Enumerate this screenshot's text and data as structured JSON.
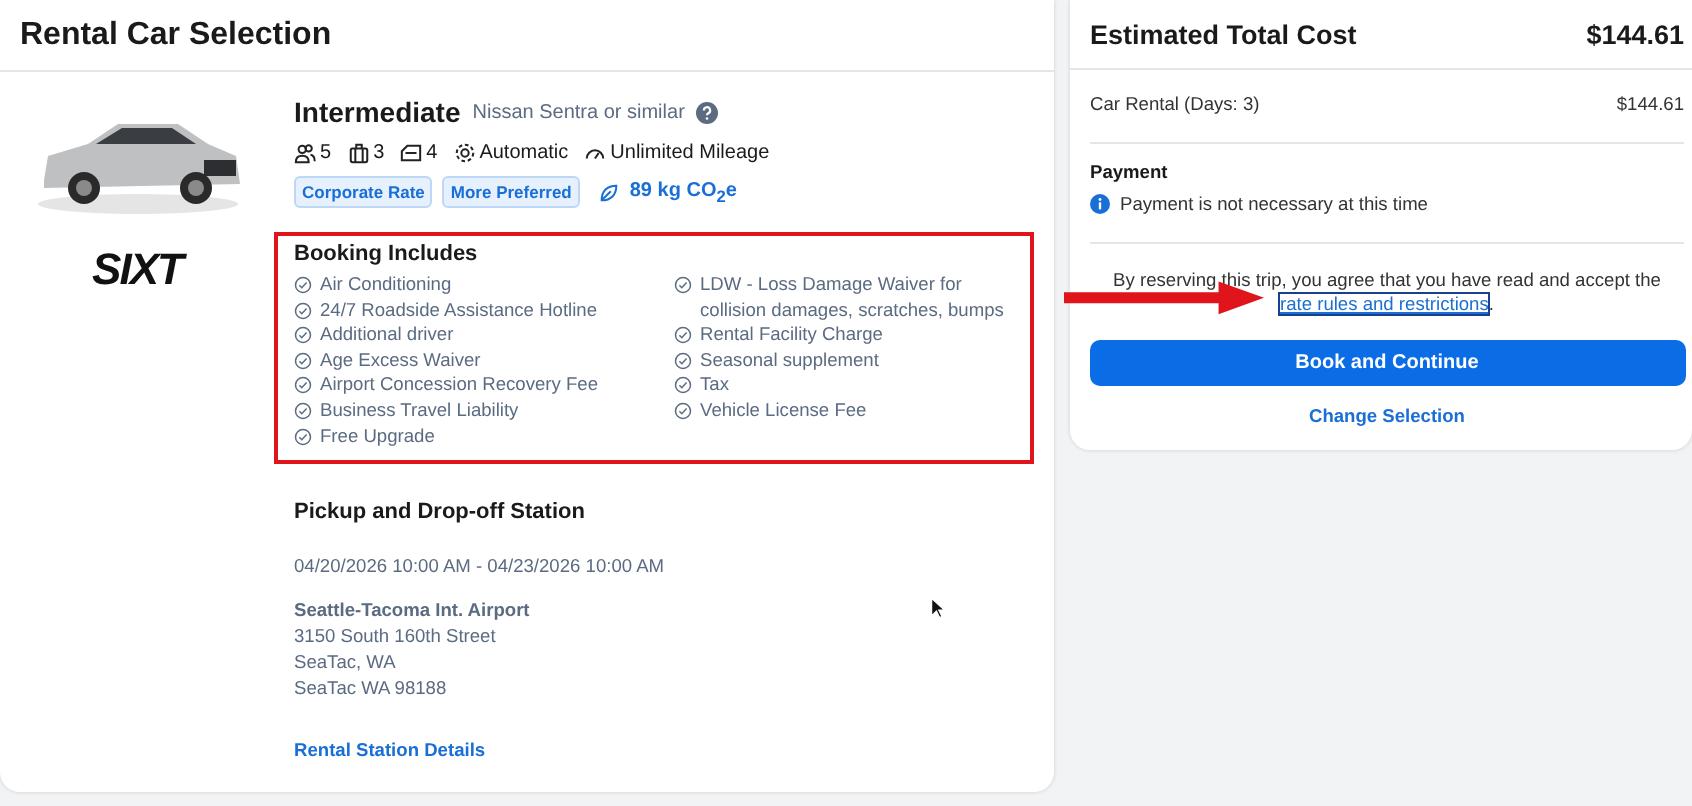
{
  "left_panel": {
    "title": "Rental Car Selection",
    "car": {
      "picture": {
        "kind": "picture"
      },
      "vendor_logo": "SIXT",
      "class": "Intermediate",
      "model": "Nissan Sentra or similar",
      "features": [
        {
          "kind": "passengers",
          "label": "5"
        },
        {
          "kind": "bags",
          "label": "3"
        },
        {
          "kind": "doors",
          "label": "4"
        },
        {
          "kind": "transmission",
          "label": "Automatic"
        },
        {
          "kind": "mileage",
          "label": "Unlimited Mileage"
        }
      ],
      "tags": [
        "Corporate Rate",
        "More Preferred"
      ],
      "emissions": "89 kg CO$_{2}$e"
    },
    "booking_includes": {
      "title": "Booking Includes",
      "columns": [
        [
          "Air Conditioning",
          "24/7 Roadside Assistance Hotline",
          "Additional driver",
          "Age Excess Waiver",
          "Airport Concession Recovery Fee",
          "Business Travel Liability",
          "Free Upgrade"
        ],
        [
          "LDW - Loss Damage Waiver for collision damages, scratches, bumps",
          "Rental Facility Charge",
          "Seasonal supplement",
          "Tax",
          "Vehicle License Fee"
        ]
      ]
    },
    "station": {
      "title": "Pickup and Drop-off Station",
      "dates": "04/20/2026 10:00 AM - 04/23/2026 10:00 AM",
      "name": "Seattle-Tacoma Int. Airport",
      "address": [
        "3150 South 160th Street",
        "SeaTac, WA",
        "SeaTac WA 98188"
      ],
      "details_link": "Rental Station Details"
    }
  },
  "right_panel": {
    "title": "Estimated Total Cost",
    "total": "$144.61",
    "line_items": [
      {
        "label": "Car Rental (Days: 3)",
        "amount": "$144.61"
      }
    ],
    "payment": {
      "title": "Payment",
      "note": "Payment is not necessary at this time"
    },
    "agreement": {
      "text": "By reserving this trip, you agree that you have read and accept the",
      "link": "rate rules and restrictions",
      "after": "."
    },
    "primary_button": "Book and Continue",
    "secondary_link": "Change Selection"
  }
}
